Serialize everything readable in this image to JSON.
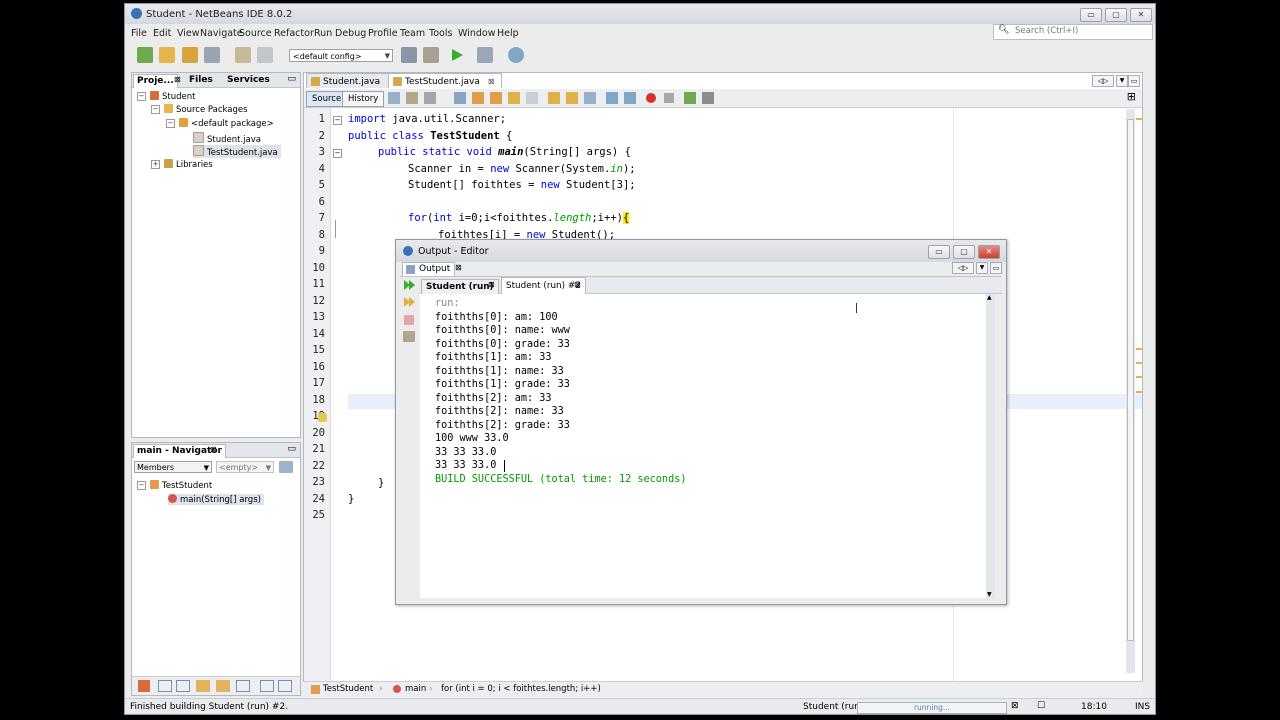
{
  "window": {
    "title": "Student - NetBeans IDE 8.0.2",
    "controls": [
      "▭",
      "▢",
      "✕"
    ]
  },
  "menu": [
    "File",
    "Edit",
    "View",
    "Navigate",
    "Source",
    "Refactor",
    "Run",
    "Debug",
    "Profile",
    "Team",
    "Tools",
    "Window",
    "Help"
  ],
  "search": {
    "placeholder": "Search (Ctrl+I)"
  },
  "toolbar": {
    "config": "<default config>"
  },
  "projects_panel": {
    "tabs": [
      "Proje...",
      "Files",
      "Services"
    ],
    "tree": [
      {
        "label": "Student",
        "icon": "project-icon"
      },
      {
        "label": "Source Packages",
        "icon": "package-folder-icon"
      },
      {
        "label": "<default package>",
        "icon": "package-icon"
      },
      {
        "label": "Student.java",
        "icon": "java-file-icon"
      },
      {
        "label": "TestStudent.java",
        "icon": "java-file-icon"
      },
      {
        "label": "Libraries",
        "icon": "library-icon"
      }
    ]
  },
  "navigator": {
    "title": "main - Navigator",
    "members": "Members",
    "filter": "<empty>",
    "tree": [
      {
        "label": "TestStudent",
        "icon": "class-icon"
      },
      {
        "label": "main(String[] args)",
        "icon": "method-icon"
      }
    ]
  },
  "editor": {
    "tabs": [
      "Student.java",
      "TestStudent.java"
    ],
    "source_button": "Source",
    "history_button": "History",
    "line_numbers": [
      "1",
      "2",
      "3",
      "4",
      "5",
      "6",
      "7",
      "8",
      "9",
      "10",
      "11",
      "12",
      "13",
      "14",
      "15",
      "16",
      "17",
      "18",
      "19",
      "20",
      "21",
      "22",
      "23",
      "24",
      "25"
    ],
    "code": {
      "l1_kw": "import",
      "l1_rest": " java.util.Scanner;",
      "l2_kw": "public class",
      "l2_name": "TestStudent",
      "l2_rest": " {",
      "l3_kw": "public static void",
      "l3_name": "main",
      "l3_rest": "(String[] args) {",
      "l4_a": "Scanner in = ",
      "l4_kw": "new",
      "l4_b": " Scanner(System.",
      "l4_fld": "in",
      "l4_c": ");",
      "l5_a": "Student[] foithtes = ",
      "l5_kw": "new",
      "l5_b": " Student[3];",
      "l7_kw1": "for",
      "l7_a": "(",
      "l7_kw2": "int",
      "l7_b": " i=0;i<foithtes.",
      "l7_fld": "length",
      "l7_c": ";i++)",
      "l7_brace": "{",
      "l8_a": "foithtes[i] = ",
      "l8_kw": "new",
      "l8_b": " Student();",
      "l23": "}",
      "l24": "}"
    }
  },
  "breadcrumb": [
    "TestStudent",
    "main",
    "for (int i = 0; i < foithtes.length; i++)"
  ],
  "output": {
    "title": "Output - Editor",
    "tab": "Output",
    "subtabs": [
      "Student (run)",
      "Student (run) #2"
    ],
    "lines": [
      "run:",
      "foithths[0]: am: 100",
      "foithths[0]: name: www",
      "foithths[0]: grade: 33",
      "foithths[1]: am: 33",
      "foithths[1]: name: 33",
      "foithths[1]: grade: 33",
      "foithths[2]: am: 33",
      "foithths[2]: name: 33",
      "foithths[2]: grade: 33",
      "100 www 33.0",
      "33 33 33.0",
      "33 33 33.0"
    ],
    "build": "BUILD SUCCESSFUL (total time: 12 seconds)"
  },
  "status": {
    "message": "Finished building Student (run) #2.",
    "task": "Student (run)",
    "progress": "running...",
    "position": "18:10",
    "mode": "INS"
  },
  "colors": {
    "keyword": "#0000e6",
    "field": "#009900",
    "build": "#009900",
    "run": "#888888"
  }
}
